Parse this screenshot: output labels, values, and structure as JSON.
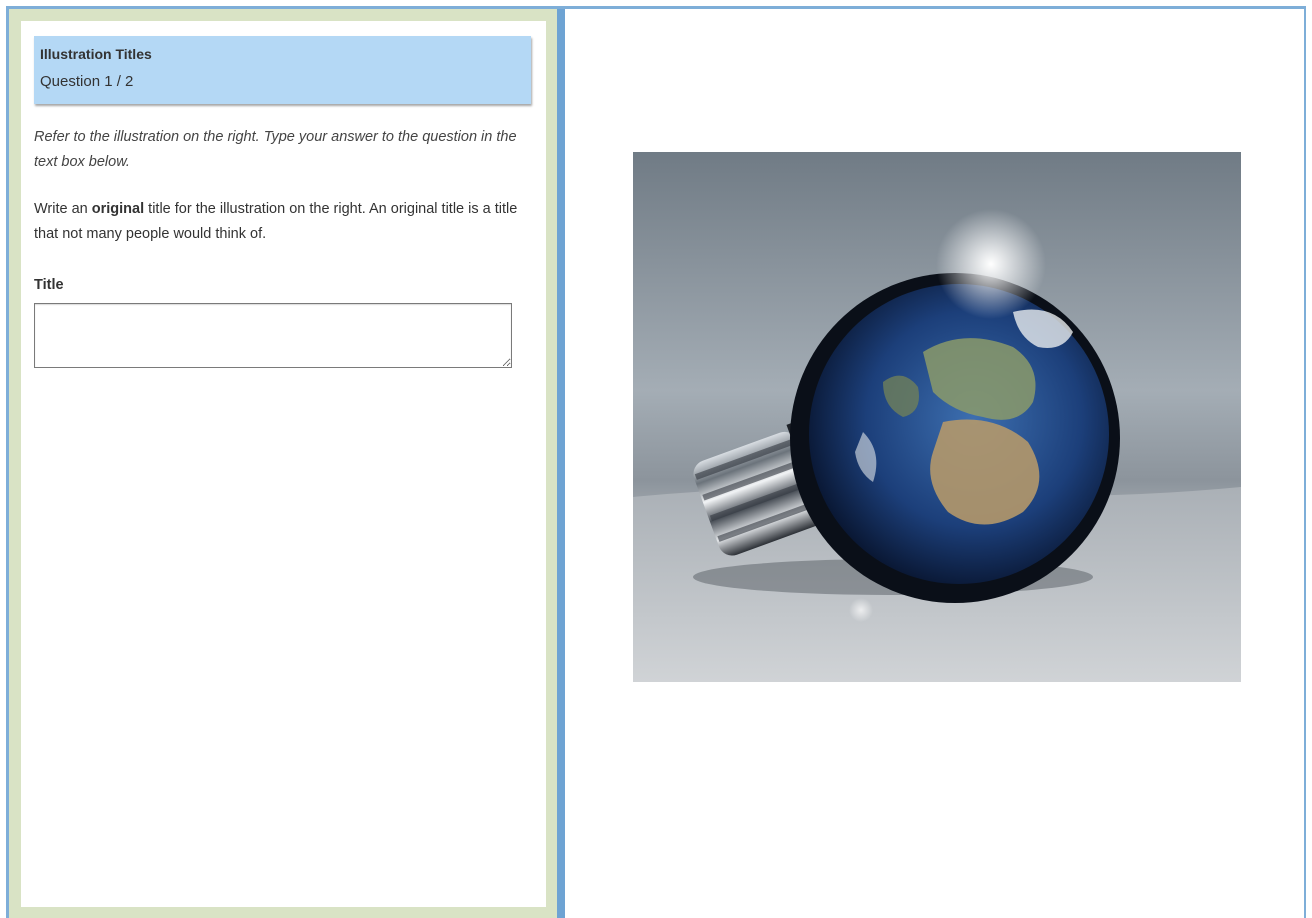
{
  "header": {
    "title": "Illustration Titles",
    "question_counter": "Question 1 / 2"
  },
  "instructions": "Refer to the illustration on the right. Type your answer to the question in the text box below.",
  "question": {
    "part1": "Write an ",
    "emphasis": "original",
    "part2": " title for the illustration on the right. An original title is a title that not many people would think of."
  },
  "answer": {
    "label": "Title",
    "value": "",
    "placeholder": ""
  },
  "illustration": {
    "subject": "light bulb containing the Earth"
  },
  "colors": {
    "header_bg": "#b4d8f5",
    "panel_border": "#d9e3c5",
    "divider": "#6ea3d3"
  }
}
